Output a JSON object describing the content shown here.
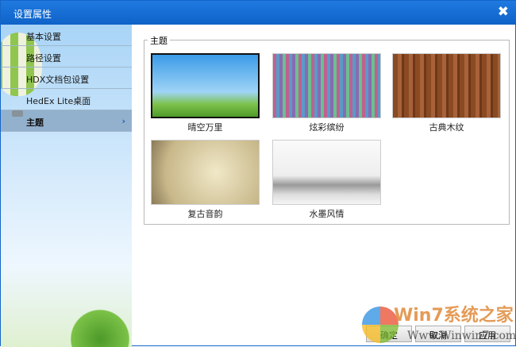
{
  "window": {
    "title": "设置属性",
    "close_icon": "close-icon"
  },
  "sidebar": {
    "items": [
      {
        "label": "基本设置"
      },
      {
        "label": "路径设置"
      },
      {
        "label": "HDX文档包设置"
      },
      {
        "label": "HedEx Lite桌面"
      },
      {
        "label": "主题",
        "selected": true
      }
    ],
    "chevron": "›"
  },
  "group": {
    "label": "主题"
  },
  "themes": [
    {
      "label": "晴空万里",
      "selected": true
    },
    {
      "label": "炫彩缤纷"
    },
    {
      "label": "古典木纹"
    },
    {
      "label": "复古音韵"
    },
    {
      "label": "水墨风情"
    }
  ],
  "buttons": {
    "ok": "确定",
    "cancel": "取消",
    "apply": "应用"
  },
  "watermark": {
    "brand": "Win7系统之家",
    "url": "Www.Winwin7.com"
  }
}
